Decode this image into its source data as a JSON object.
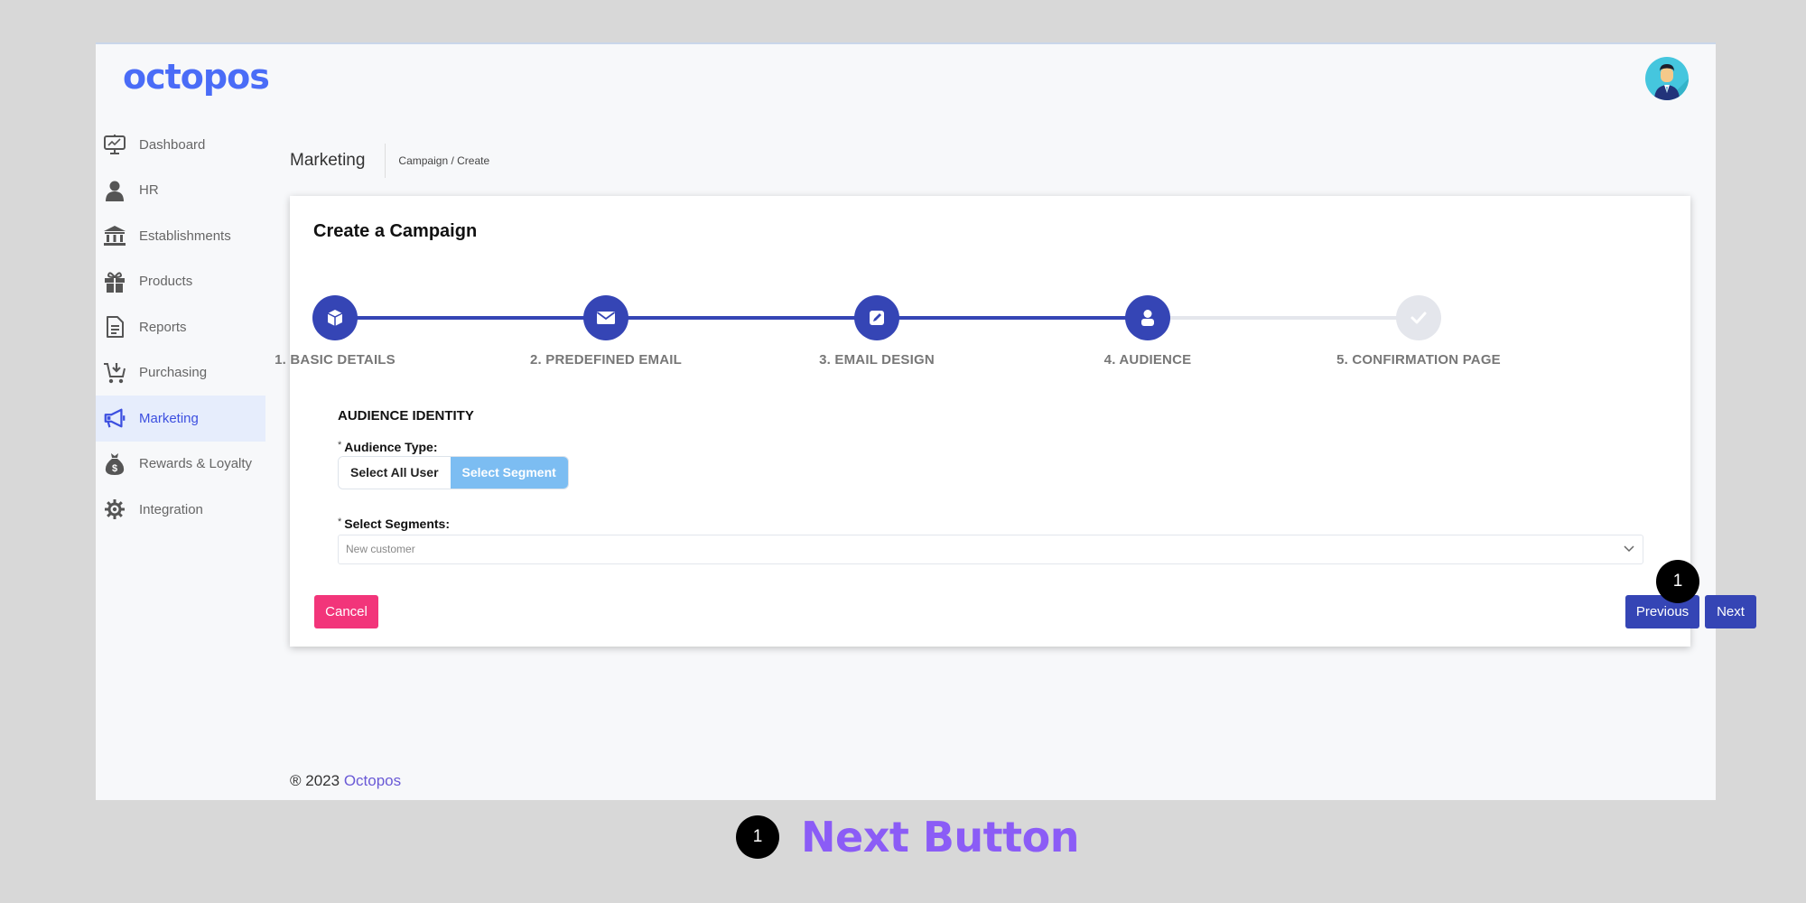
{
  "app": {
    "logo": "octopos",
    "avatar_icon": "user-avatar"
  },
  "sidebar": {
    "items": [
      {
        "label": "Dashboard",
        "icon": "dashboard-monitor-icon",
        "active": false
      },
      {
        "label": "HR",
        "icon": "person-icon",
        "active": false
      },
      {
        "label": "Establishments",
        "icon": "bank-building-icon",
        "active": false
      },
      {
        "label": "Products",
        "icon": "gift-icon",
        "active": false
      },
      {
        "label": "Reports",
        "icon": "document-icon",
        "active": false
      },
      {
        "label": "Purchasing",
        "icon": "cart-icon",
        "active": false
      },
      {
        "label": "Marketing",
        "icon": "megaphone-icon",
        "active": true
      },
      {
        "label": "Rewards & Loyalty",
        "icon": "money-bag-icon",
        "active": false
      },
      {
        "label": "Integration",
        "icon": "gear-icon",
        "active": false
      }
    ]
  },
  "header": {
    "title": "Marketing",
    "breadcrumb": "Campaign / Create"
  },
  "card": {
    "title": "Create a Campaign",
    "steps": [
      {
        "label": "1. BASIC DETAILS",
        "icon": "cube-icon",
        "status": "done"
      },
      {
        "label": "2. PREDEFINED EMAIL",
        "icon": "envelope-icon",
        "status": "done"
      },
      {
        "label": "3. EMAIL DESIGN",
        "icon": "edit-icon",
        "status": "done"
      },
      {
        "label": "4. AUDIENCE",
        "icon": "user-icon",
        "status": "active"
      },
      {
        "label": "5. CONFIRMATION PAGE",
        "icon": "check-icon",
        "status": "pending"
      }
    ],
    "section_title": "AUDIENCE IDENTITY",
    "audience_type": {
      "required_mark": "*",
      "label": "Audience Type:",
      "options": [
        "Select All User",
        "Select Segment"
      ],
      "selected": "Select Segment"
    },
    "segments": {
      "required_mark": "*",
      "label": "Select Segments:",
      "value": "New customer"
    },
    "buttons": {
      "cancel": "Cancel",
      "previous": "Previous",
      "next": "Next"
    }
  },
  "footer": {
    "copyright": "® 2023",
    "brand": "Octopos"
  },
  "annotation": {
    "number": "1",
    "label": "Next Button"
  },
  "colors": {
    "primary": "#3545b5",
    "accent_logo": "#4a6cf7",
    "cancel": "#f2357a",
    "toggle_active": "#7cbdf2",
    "annotation_label": "#8b5cf6"
  }
}
